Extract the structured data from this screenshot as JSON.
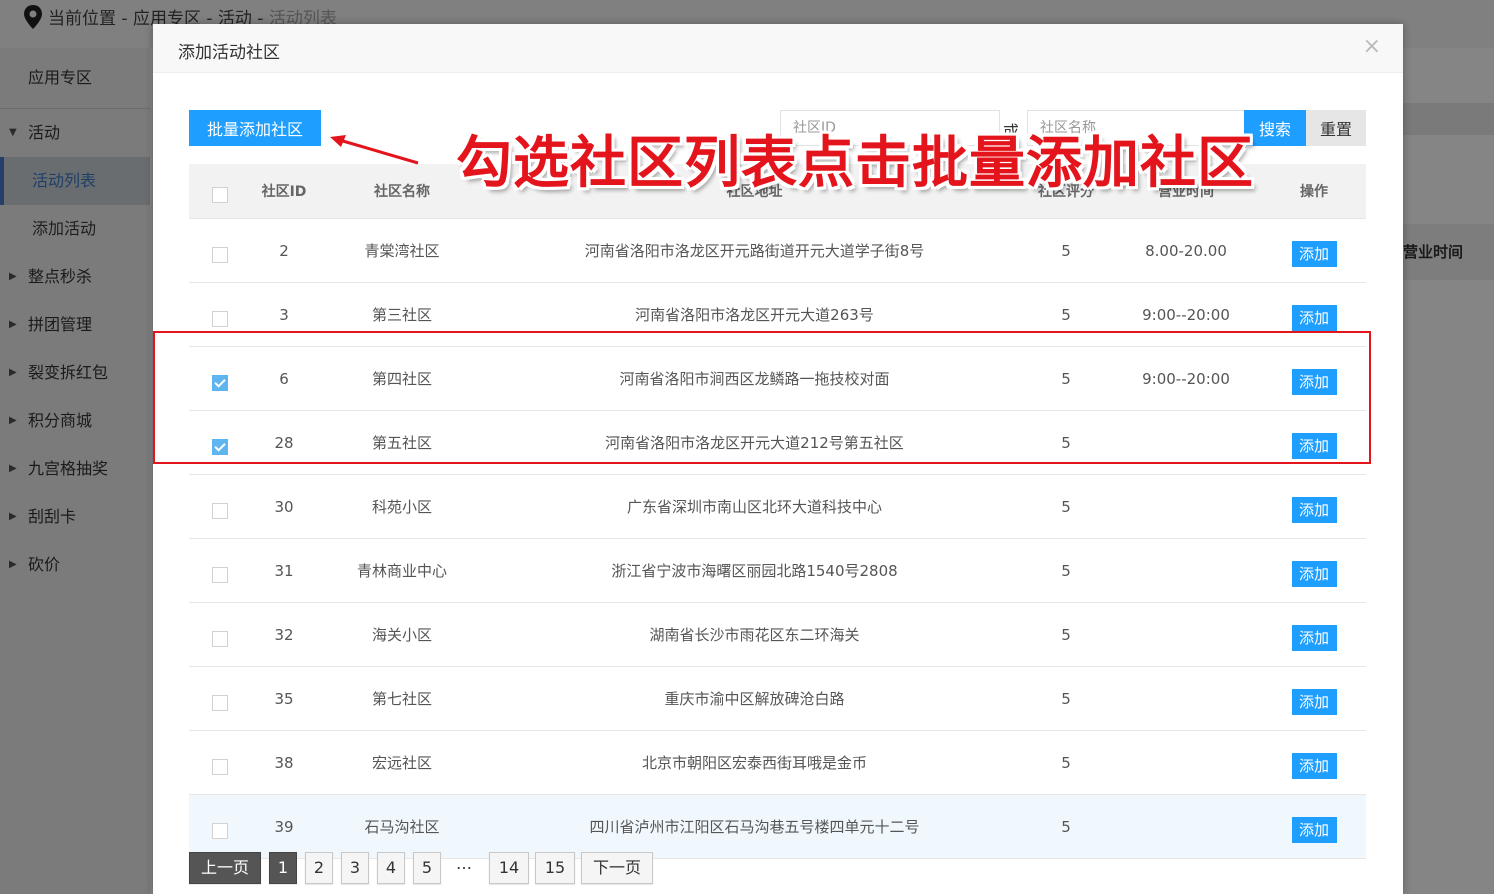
{
  "background": {
    "breadcrumb": [
      "当前位置 - ",
      "应用专区 - ",
      "活动 - "
    ],
    "breadcrumb_current": "活动列表",
    "sidebar": {
      "root": "应用专区",
      "groups": [
        {
          "label": "活动",
          "children": [
            "活动列表",
            "添加活动"
          ]
        },
        {
          "label": "整点秒杀"
        },
        {
          "label": "拼团管理"
        },
        {
          "label": "裂变拆红包"
        },
        {
          "label": "积分商城"
        },
        {
          "label": "九宫格抽奖"
        },
        {
          "label": "刮刮卡"
        },
        {
          "label": "砍价"
        }
      ]
    },
    "main_column_header": "营业时间"
  },
  "modal": {
    "title": "添加活动社区",
    "close_glyph": "×",
    "batch_add_label": "批量添加社区",
    "search": {
      "id_placeholder": "社区ID",
      "or_text": "或",
      "name_placeholder": "社区名称",
      "search_label": "搜索",
      "reset_label": "重置"
    },
    "table": {
      "headers": [
        "社区ID",
        "社区名称",
        "社区地址",
        "社区评分",
        "营业时间",
        "操作"
      ],
      "add_label": "添加",
      "rows": [
        {
          "id": "2",
          "name": "青棠湾社区",
          "address": "河南省洛阳市洛龙区开元路街道开元大道学子街8号",
          "score": "5",
          "hours": "8.00-20.00",
          "checked": false
        },
        {
          "id": "3",
          "name": "第三社区",
          "address": "河南省洛阳市洛龙区开元大道263号",
          "score": "5",
          "hours": "9:00--20:00",
          "checked": false
        },
        {
          "id": "6",
          "name": "第四社区",
          "address": "河南省洛阳市涧西区龙鳞路一拖技校对面",
          "score": "5",
          "hours": "9:00--20:00",
          "checked": true
        },
        {
          "id": "28",
          "name": "第五社区",
          "address": "河南省洛阳市洛龙区开元大道212号第五社区",
          "score": "5",
          "hours": "",
          "checked": true
        },
        {
          "id": "30",
          "name": "科苑小区",
          "address": "广东省深圳市南山区北环大道科技中心",
          "score": "5",
          "hours": "",
          "checked": false
        },
        {
          "id": "31",
          "name": "青林商业中心",
          "address": "浙江省宁波市海曙区丽园北路1540号2808",
          "score": "5",
          "hours": "",
          "checked": false
        },
        {
          "id": "32",
          "name": "海关小区",
          "address": "湖南省长沙市雨花区东二环海关",
          "score": "5",
          "hours": "",
          "checked": false
        },
        {
          "id": "35",
          "name": "第七社区",
          "address": "重庆市渝中区解放碑沧白路",
          "score": "5",
          "hours": "",
          "checked": false
        },
        {
          "id": "38",
          "name": "宏远社区",
          "address": "北京市朝阳区宏泰西街耳哦是金币",
          "score": "5",
          "hours": "",
          "checked": false
        },
        {
          "id": "39",
          "name": "石马沟社区",
          "address": "四川省泸州市江阳区石马沟巷五号楼四单元十二号",
          "score": "5",
          "hours": "",
          "checked": false
        }
      ]
    },
    "pagination": {
      "prev": "上一页",
      "pages": [
        "1",
        "2",
        "3",
        "4",
        "5"
      ],
      "current": "1",
      "dots": "…",
      "tail_pages": [
        "14",
        "15"
      ],
      "next": "下一页"
    }
  },
  "annotation": {
    "text": "勾选社区列表点击批量添加社区",
    "color": "#e3141b"
  }
}
